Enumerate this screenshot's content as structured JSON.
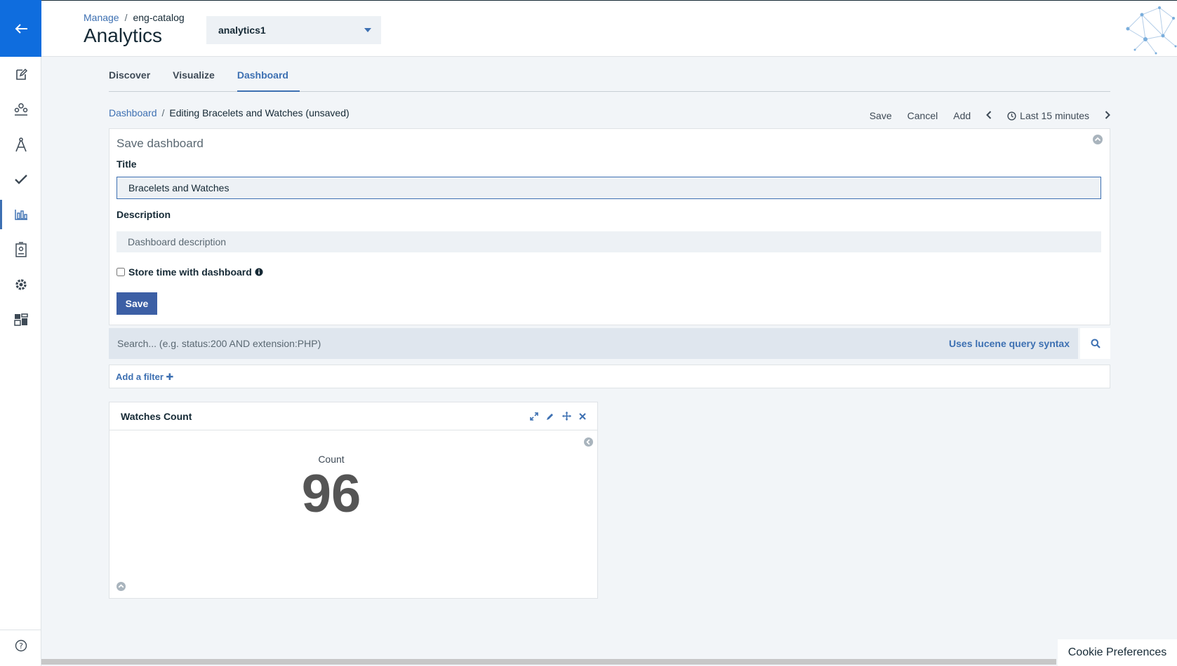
{
  "header": {
    "breadcrumb": {
      "root": "Manage",
      "current": "eng-catalog"
    },
    "title": "Analytics",
    "instance_select": {
      "value": "analytics1"
    }
  },
  "tabs": [
    {
      "label": "Discover"
    },
    {
      "label": "Visualize"
    },
    {
      "label": "Dashboard",
      "active": true
    }
  ],
  "dashboard": {
    "breadcrumb": {
      "root": "Dashboard",
      "current": "Editing Bracelets and Watches (unsaved)"
    },
    "toolbar": {
      "save": "Save",
      "cancel": "Cancel",
      "add": "Add",
      "time_range": "Last 15 minutes"
    }
  },
  "save_panel": {
    "heading": "Save dashboard",
    "title_label": "Title",
    "title_value": "Bracelets and Watches",
    "description_label": "Description",
    "description_placeholder": "Dashboard description",
    "store_time_label": "Store time with dashboard",
    "save_button": "Save"
  },
  "search": {
    "placeholder": "Search... (e.g. status:200 AND extension:PHP)",
    "syntax_link": "Uses lucene query syntax"
  },
  "filter": {
    "add_label": "Add a filter"
  },
  "panel_card": {
    "title": "Watches Count",
    "metric_label": "Count",
    "metric_value": "96"
  },
  "cookie": {
    "label": "Cookie Preferences"
  },
  "colors": {
    "accent": "#3d70b2",
    "rail_back": "#0f6dde",
    "primary_button": "#3c5fa5"
  }
}
